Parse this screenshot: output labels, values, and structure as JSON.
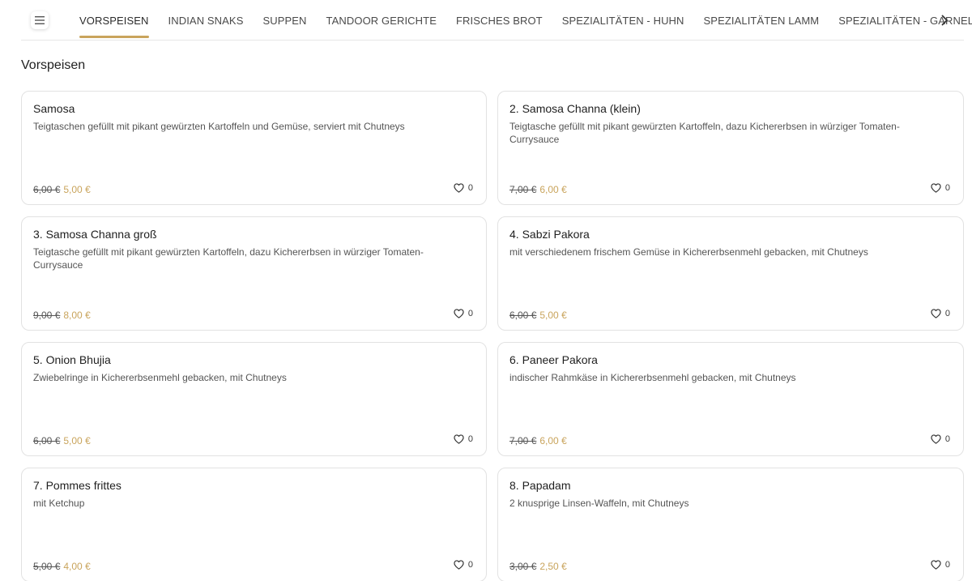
{
  "nav": {
    "tabs": [
      {
        "label": "VORSPEISEN",
        "active": true
      },
      {
        "label": "INDIAN SNAKS",
        "active": false
      },
      {
        "label": "SUPPEN",
        "active": false
      },
      {
        "label": "TANDOOR GERICHTE",
        "active": false
      },
      {
        "label": "FRISCHES BROT",
        "active": false
      },
      {
        "label": "SPEZIALITÄTEN - HUHN",
        "active": false
      },
      {
        "label": "SPEZIALITÄTEN LAMM",
        "active": false
      },
      {
        "label": "SPEZIALITÄTEN - GARNELEN",
        "active": false
      }
    ],
    "menu_icon": "hamburger-menu-icon",
    "next_icon": "chevron-right-icon"
  },
  "section": {
    "title": "Vorspeisen"
  },
  "colors": {
    "accent": "#c9a45c",
    "card_border": "#e2e2e2",
    "divider": "#e6e6e6"
  },
  "items": [
    {
      "name": "Samosa",
      "description": "Teigtaschen gefüllt mit pikant gewürzten Kartoffeln und Gemüse, serviert mit Chutneys",
      "old_price": "6,00 €",
      "price": "5,00 €",
      "likes": "0"
    },
    {
      "name": "2. Samosa Channa (klein)",
      "description": "Teigtasche gefüllt mit pikant gewürzten Kartoffeln, dazu Kichererbsen in würziger Tomaten-Currysauce",
      "old_price": "7,00 €",
      "price": "6,00 €",
      "likes": "0"
    },
    {
      "name": "3. Samosa Channa groß",
      "description": "Teigtasche gefüllt mit pikant gewürzten Kartoffeln, dazu Kichererbsen in würziger Tomaten-Currysauce",
      "old_price": "9,00 €",
      "price": "8,00 €",
      "likes": "0"
    },
    {
      "name": "4. Sabzi Pakora",
      "description": "mit verschiedenem frischem Gemüse in Kichererbsenmehl gebacken, mit Chutneys",
      "old_price": "6,00 €",
      "price": "5,00 €",
      "likes": "0"
    },
    {
      "name": "5. Onion Bhujia",
      "description": "Zwiebelringe in Kichererbsenmehl gebacken, mit Chutneys",
      "old_price": "6,00 €",
      "price": "5,00 €",
      "likes": "0"
    },
    {
      "name": "6. Paneer Pakora",
      "description": "indischer Rahmkäse in Kichererbsenmehl gebacken, mit Chutneys",
      "old_price": "7,00 €",
      "price": "6,00 €",
      "likes": "0"
    },
    {
      "name": "7. Pommes frittes",
      "description": "mit Ketchup",
      "old_price": "5,00 €",
      "price": "4,00 €",
      "likes": "0"
    },
    {
      "name": "8. Papadam",
      "description": "2 knusprige Linsen-Waffeln, mit Chutneys",
      "old_price": "3,00 €",
      "price": "2,50 €",
      "likes": "0"
    }
  ]
}
